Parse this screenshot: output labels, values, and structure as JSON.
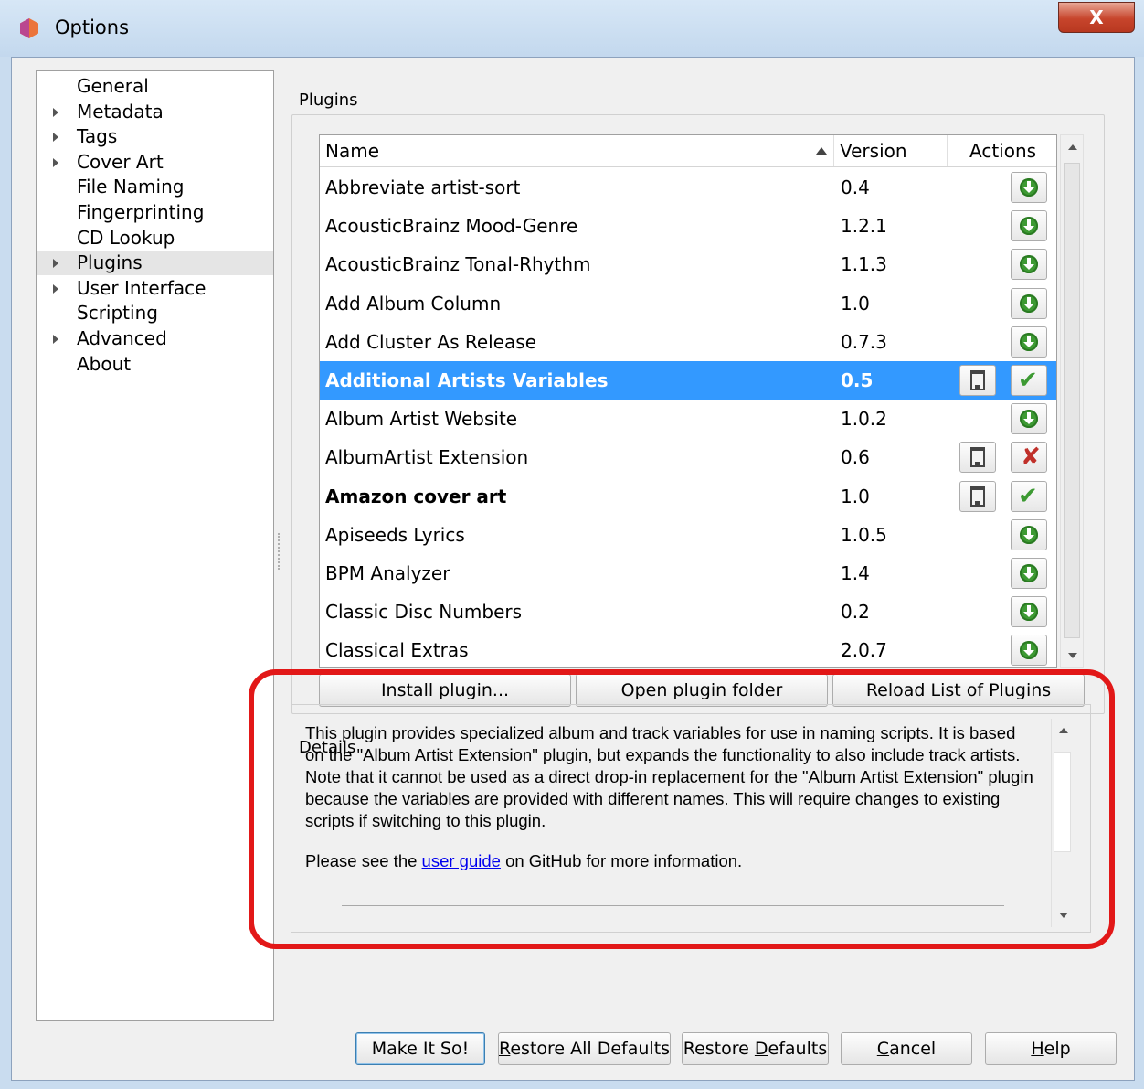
{
  "window": {
    "title": "Options",
    "close_glyph": "X"
  },
  "nav": {
    "items": [
      {
        "label": "General",
        "expandable": false
      },
      {
        "label": "Metadata",
        "expandable": true
      },
      {
        "label": "Tags",
        "expandable": true
      },
      {
        "label": "Cover Art",
        "expandable": true
      },
      {
        "label": "File Naming",
        "expandable": false
      },
      {
        "label": "Fingerprinting",
        "expandable": false
      },
      {
        "label": "CD Lookup",
        "expandable": false
      },
      {
        "label": "Plugins",
        "expandable": true,
        "selected": true
      },
      {
        "label": "User Interface",
        "expandable": true
      },
      {
        "label": "Scripting",
        "expandable": false
      },
      {
        "label": "Advanced",
        "expandable": true
      },
      {
        "label": "About",
        "expandable": false
      }
    ]
  },
  "plugins": {
    "section_label": "Plugins",
    "columns": {
      "name": "Name",
      "version": "Version",
      "actions": "Actions"
    },
    "sort": {
      "column": "Name",
      "direction": "ascending"
    },
    "rows": [
      {
        "name": "Abbreviate artist-sort",
        "version": "0.4",
        "installed": false
      },
      {
        "name": "AcousticBrainz Mood-Genre",
        "version": "1.2.1",
        "installed": false
      },
      {
        "name": "AcousticBrainz Tonal-Rhythm",
        "version": "1.1.3",
        "installed": false
      },
      {
        "name": "Add Album Column",
        "version": "1.0",
        "installed": false
      },
      {
        "name": "Add Cluster As Release",
        "version": "0.7.3",
        "installed": false
      },
      {
        "name": "Additional Artists Variables",
        "version": "0.5",
        "installed": true,
        "enabled": true,
        "selected": true
      },
      {
        "name": "Album Artist Website",
        "version": "1.0.2",
        "installed": false
      },
      {
        "name": "AlbumArtist Extension",
        "version": "0.6",
        "installed": true,
        "enabled": false
      },
      {
        "name": "Amazon cover art",
        "version": "1.0",
        "installed": true,
        "enabled": true,
        "bold": true
      },
      {
        "name": "Apiseeds Lyrics",
        "version": "1.0.5",
        "installed": false
      },
      {
        "name": "BPM Analyzer",
        "version": "1.4",
        "installed": false
      },
      {
        "name": "Classic Disc Numbers",
        "version": "0.2",
        "installed": false
      },
      {
        "name": "Classical Extras",
        "version": "2.0.7",
        "installed": false
      }
    ],
    "buttons": {
      "install": "Install plugin...",
      "open_folder": "Open plugin folder",
      "reload": "Reload List of Plugins"
    }
  },
  "details": {
    "section_label": "Details",
    "description": "This plugin provides specialized album and track variables for use in naming scripts. It is based on the \"Album Artist Extension\" plugin, but expands the functionality to also include track artists. Note that it cannot be used as a direct drop-in replacement for the \"Album Artist Extension\" plugin because the variables are provided with different names. This will require changes to existing scripts if switching to this plugin.",
    "more_info_prefix": "Please see the ",
    "more_info_link": "user guide",
    "more_info_suffix": " on GitHub for more information."
  },
  "footer": {
    "make_it_so": "Make It So!",
    "restore_all": {
      "pre": "",
      "key": "R",
      "post": "estore All Defaults"
    },
    "restore": {
      "pre": "Restore ",
      "key": "D",
      "post": "efaults"
    },
    "cancel": {
      "pre": "",
      "key": "C",
      "post": "ancel"
    },
    "help": {
      "pre": "",
      "key": "H",
      "post": "elp"
    }
  },
  "colors": {
    "selection": "#3399ff",
    "annotation": "#e21818",
    "download_icon": "#3d9a33",
    "disabled_icon": "#c0302a"
  }
}
